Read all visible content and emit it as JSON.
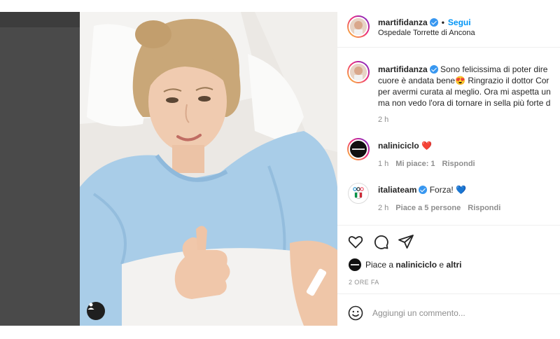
{
  "post": {
    "username": "martifidanza",
    "dot": "•",
    "follow_label": "Segui",
    "location": "Ospedale Torrette di Ancona"
  },
  "caption": {
    "username": "martifidanza",
    "line1": "Sono felicissima di poter dire",
    "line2": "cuore è andata bene😍 Ringrazio il dottor Cor",
    "line3": "per avermi curata al meglio. Ora mi aspetta un",
    "line4": "ma non vedo l'ora di tornare in sella più forte d",
    "time": "2 h"
  },
  "comments": [
    {
      "username": "naliniciclo",
      "text": "❤️",
      "time": "1 h",
      "likes": "Mi piace: 1",
      "reply": "Rispondi"
    },
    {
      "username": "italiateam",
      "text": "Forza! 💙",
      "time": "2 h",
      "likes": "Piace a 5 persone",
      "reply": "Rispondi"
    }
  ],
  "likes_summary": {
    "prefix": "Piace a ",
    "first_user": "naliniciclo",
    "connector": " e ",
    "others": "altri"
  },
  "time_ago": "2 ORE FA",
  "add_comment": {
    "placeholder": "Aggiungi un commento..."
  },
  "icons": {
    "like": "heart-icon",
    "comment": "comment-bubble-icon",
    "share": "paper-plane-icon",
    "emoji": "emoji-icon",
    "tag": "user-tag-icon"
  },
  "colors": {
    "link": "#0095f6",
    "verified": "#3897f0",
    "heart": "#ed4956",
    "secondary": "#8e8e8e"
  }
}
